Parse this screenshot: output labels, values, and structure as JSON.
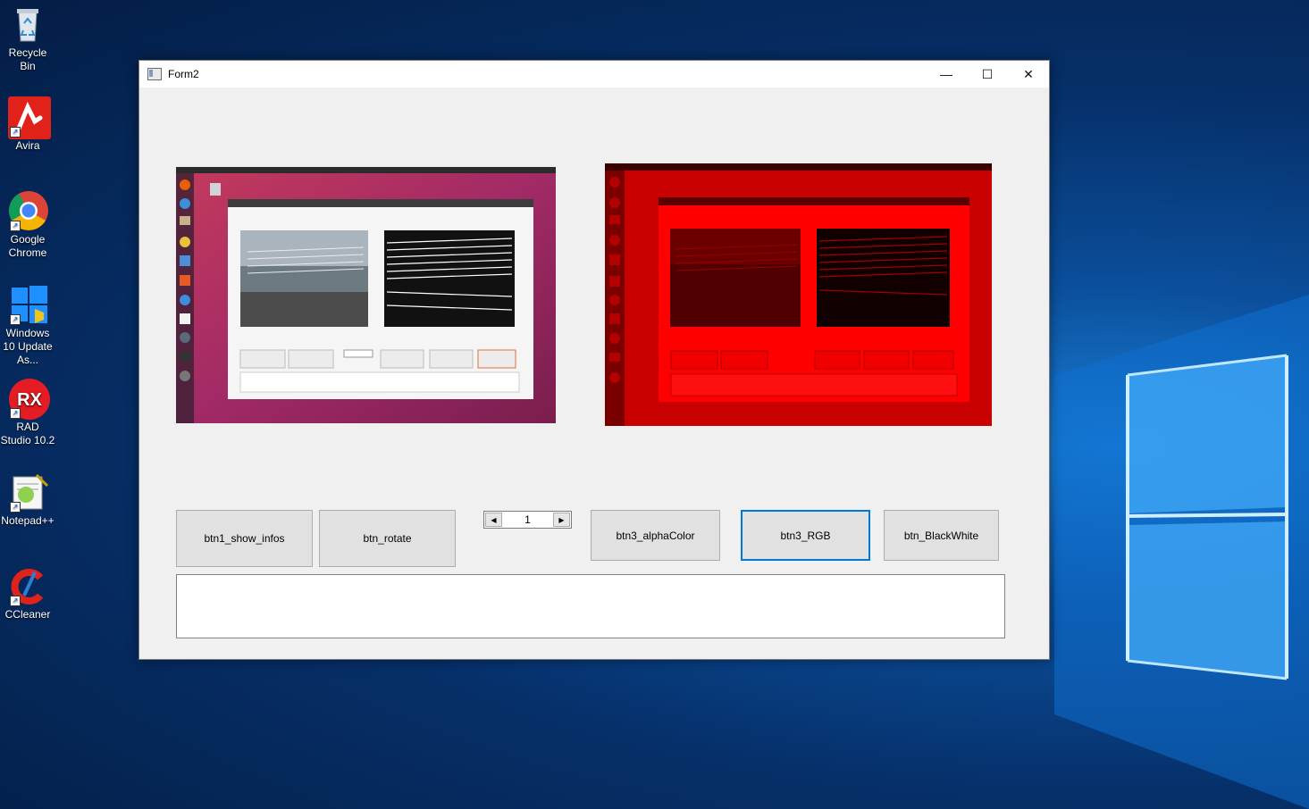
{
  "desktop": {
    "icons": [
      {
        "label": "Recycle Bin"
      },
      {
        "label": "Avira"
      },
      {
        "label": "Google Chrome"
      },
      {
        "label": "Windows 10 Update As..."
      },
      {
        "label": "RAD Studio 10.2"
      },
      {
        "label": "Notepad++"
      },
      {
        "label": "CCleaner"
      }
    ]
  },
  "window": {
    "title": "Form2",
    "controls": {
      "minimize": "—",
      "maximize": "☐",
      "close": "✕"
    }
  },
  "buttons": {
    "show_infos": "btn1_show_infos",
    "rotate": "btn_rotate",
    "alpha_color": "btn3_alphaColor",
    "rgb": "btn3_RGB",
    "black_white": "btn_BlackWhite"
  },
  "spinner": {
    "value": "1",
    "left_arrow": "◀",
    "right_arrow": "▶"
  },
  "colors": {
    "accent": "#0078d7",
    "red_filter": "#ff0000"
  }
}
